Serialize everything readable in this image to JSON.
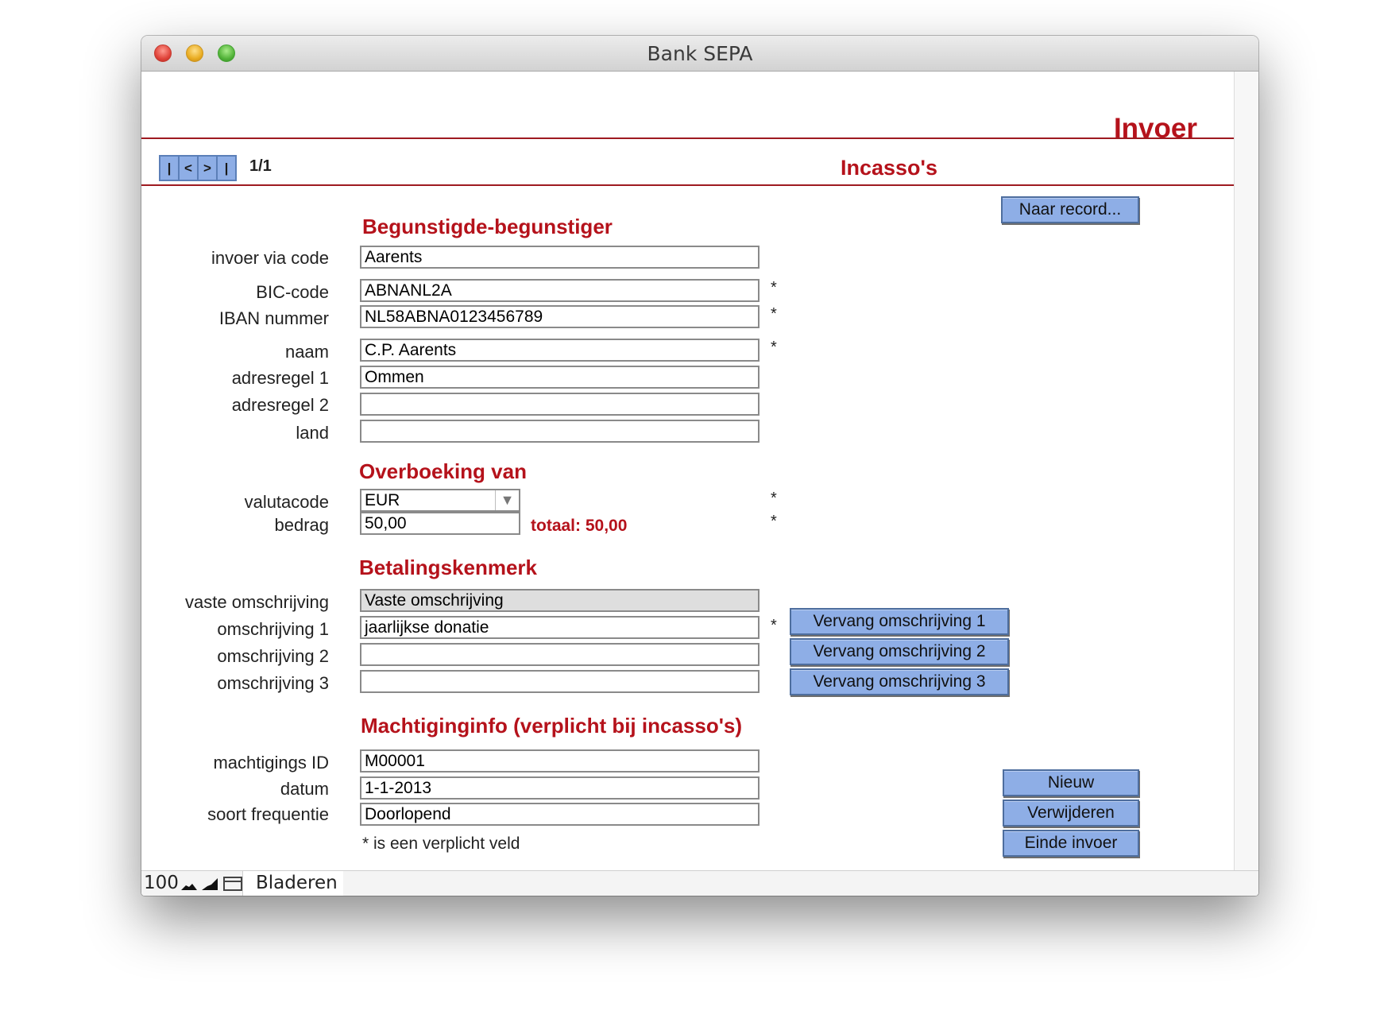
{
  "window": {
    "title": "Bank SEPA"
  },
  "header": {
    "title": "Invoer",
    "layout_title": "Incasso's"
  },
  "navigation": {
    "first": "|",
    "prev": "<",
    "next": ">",
    "last": "|",
    "record_count": "1/1"
  },
  "toolbar": {
    "goto_record": "Naar record..."
  },
  "beneficiary": {
    "heading": "Begunstigde-begunstiger",
    "fields": [
      {
        "label": "invoer via code",
        "value": "Aarents"
      },
      {
        "label": "BIC-code",
        "value": "ABNANL2A"
      },
      {
        "label": "IBAN nummer",
        "value": "NL58ABNA0123456789"
      },
      {
        "label": "naam",
        "value": "C.P. Aarents"
      },
      {
        "label": "adresregel 1",
        "value": "Ommen"
      },
      {
        "label": "adresregel 2",
        "value": ""
      },
      {
        "label": "land",
        "value": ""
      }
    ]
  },
  "transfer": {
    "heading": "Overboeking van",
    "currency_label": "valutacode",
    "currency_value": "EUR",
    "amount_label": "bedrag",
    "amount_value": "50,00",
    "total": "totaal: 50,00"
  },
  "payment_reference": {
    "heading": "Betalingskenmerk",
    "fixed_label": "vaste omschrijving",
    "fixed_value": "Vaste omschrijving",
    "descriptions": [
      {
        "label": "omschrijving 1",
        "value": "jaarlijkse donatie",
        "button": "Vervang omschrijving 1"
      },
      {
        "label": "omschrijving 2",
        "value": "",
        "button": "Vervang omschrijving 2"
      },
      {
        "label": "omschrijving 3",
        "value": "",
        "button": "Vervang omschrijving 3"
      }
    ]
  },
  "mandate": {
    "heading": "Machtiginginfo (verplicht bij incasso's)",
    "fields": [
      {
        "label": "machtigings ID",
        "value": "M00001"
      },
      {
        "label": "datum",
        "value": "1-1-2013"
      },
      {
        "label": "soort frequentie",
        "value": "Doorlopend"
      }
    ]
  },
  "required_marker": "*",
  "required_note": "* is een verplicht veld",
  "actions": {
    "new": "Nieuw",
    "delete": "Verwijderen",
    "end": "Einde invoer"
  },
  "statusbar": {
    "zoom": "100",
    "mode": "Bladeren"
  },
  "colors": {
    "accent": "#b5121b",
    "button": "#8eaee6"
  }
}
